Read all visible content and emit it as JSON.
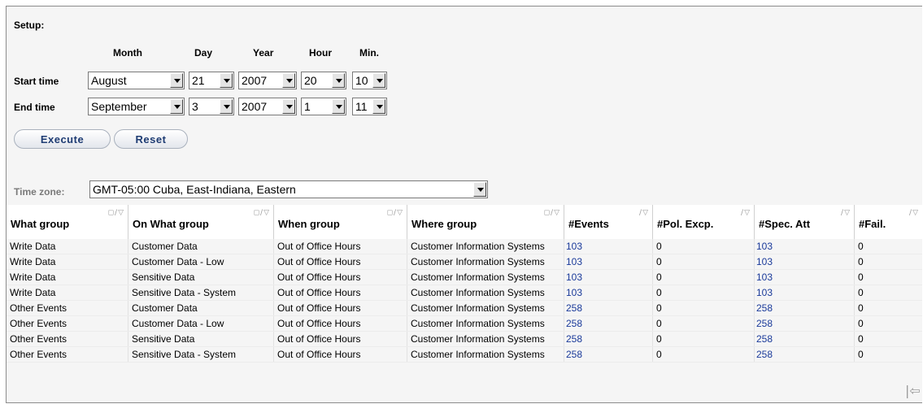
{
  "setup": {
    "title": "Setup:"
  },
  "columns": {
    "month": "Month",
    "day": "Day",
    "year": "Year",
    "hour": "Hour",
    "min": "Min."
  },
  "start": {
    "label": "Start time",
    "month": "August",
    "day": "21",
    "year": "2007",
    "hour": "20",
    "min": "10"
  },
  "end": {
    "label": "End time",
    "month": "September",
    "day": "3",
    "year": "2007",
    "hour": "1",
    "min": "11"
  },
  "buttons": {
    "execute": "Execute",
    "reset": "Reset"
  },
  "timezone": {
    "label": "Time zone:",
    "value": "GMT-05:00 Cuba, East-Indiana, Eastern"
  },
  "table": {
    "headers": [
      "What group",
      "On What group",
      "When group",
      "Where group",
      "#Events",
      "#Pol. Excp.",
      "#Spec. Att",
      "#Fail."
    ],
    "rows": [
      [
        "Write Data",
        "Customer Data",
        "Out of Office Hours",
        "Customer Information Systems",
        "103",
        "0",
        "103",
        "0"
      ],
      [
        "Write Data",
        "Customer Data - Low",
        "Out of Office Hours",
        "Customer Information Systems",
        "103",
        "0",
        "103",
        "0"
      ],
      [
        "Write Data",
        "Sensitive Data",
        "Out of Office Hours",
        "Customer Information Systems",
        "103",
        "0",
        "103",
        "0"
      ],
      [
        "Write Data",
        "Sensitive Data - System",
        "Out of Office Hours",
        "Customer Information Systems",
        "103",
        "0",
        "103",
        "0"
      ],
      [
        "Other Events",
        "Customer Data",
        "Out of Office Hours",
        "Customer Information Systems",
        "258",
        "0",
        "258",
        "0"
      ],
      [
        "Other Events",
        "Customer Data - Low",
        "Out of Office Hours",
        "Customer Information Systems",
        "258",
        "0",
        "258",
        "0"
      ],
      [
        "Other Events",
        "Sensitive Data",
        "Out of Office Hours",
        "Customer Information Systems",
        "258",
        "0",
        "258",
        "0"
      ],
      [
        "Other Events",
        "Sensitive Data - System",
        "Out of Office Hours",
        "Customer Information Systems",
        "258",
        "0",
        "258",
        "0"
      ]
    ]
  },
  "icons": {
    "sort": "sort-icon",
    "pager": "scroll-left-icon"
  }
}
